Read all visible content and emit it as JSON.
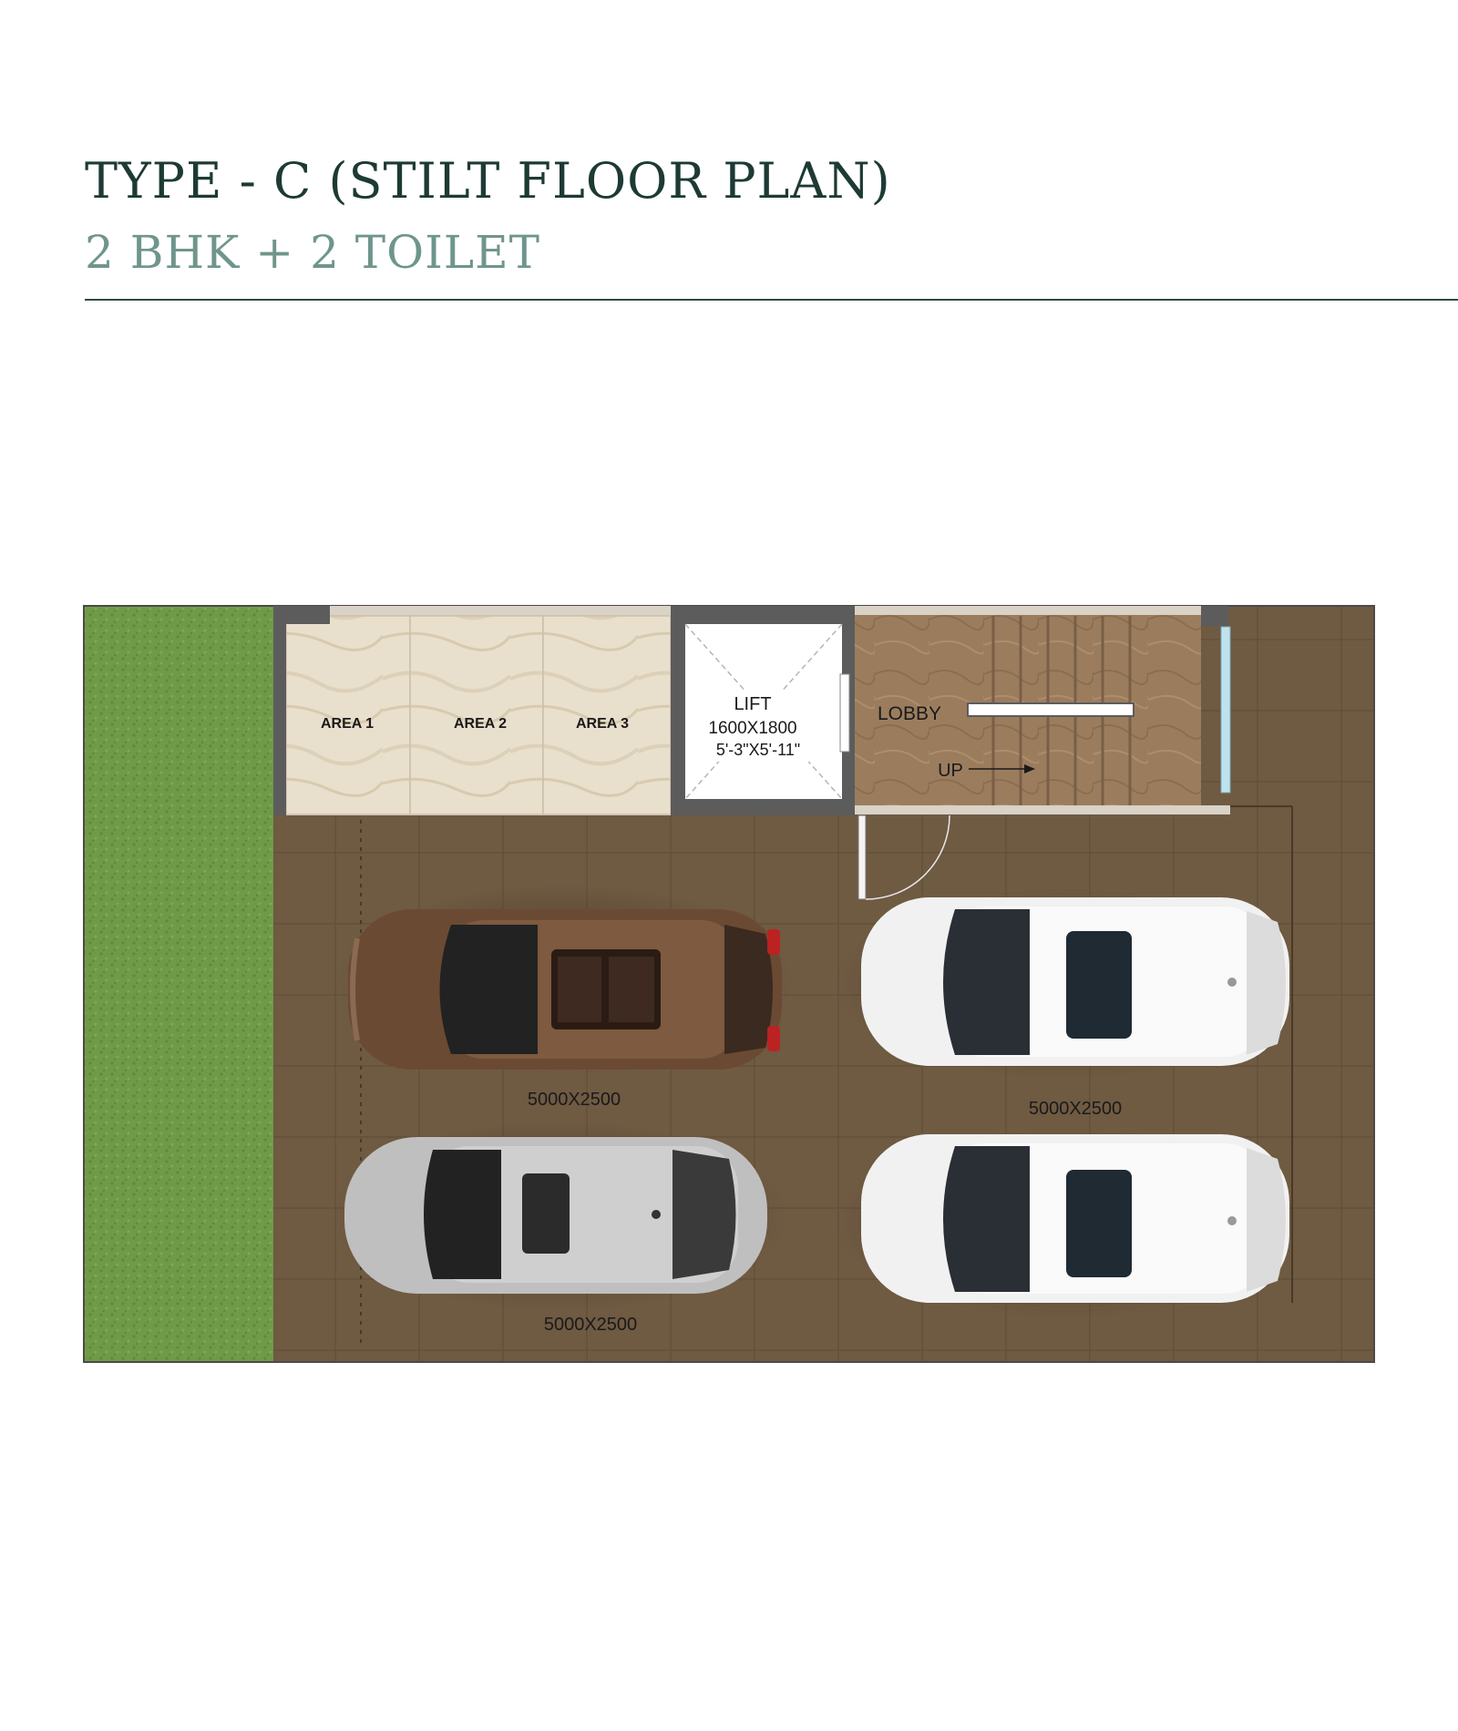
{
  "header": {
    "title": "TYPE - C (STILT FLOOR PLAN)",
    "subtitle": "2 BHK + 2 TOILET"
  },
  "plan": {
    "rooms": {
      "area1": "AREA 1",
      "area2": "AREA 2",
      "area3": "AREA 3",
      "lift_title": "LIFT",
      "lift_dims": "1600X1800",
      "lift_dims_imperial": "5'-3\"X5'-11\"",
      "lobby": "LOBBY",
      "up": "UP"
    },
    "parking": {
      "slot_top_left": "5000X2500",
      "slot_top_right": "5000X2500",
      "slot_bottom_left": "5000X2500"
    },
    "colors": {
      "lawn": "#6f9a47",
      "parking_floor": "#6f5a42",
      "lobby_floor": "#9b7d5e",
      "area_floor": "#e9dfcd",
      "wall": "#5c5c5c",
      "car_brown": "#6b4a33",
      "car_silver": "#bfbfbf",
      "car_white": "#f1f1f1"
    }
  }
}
